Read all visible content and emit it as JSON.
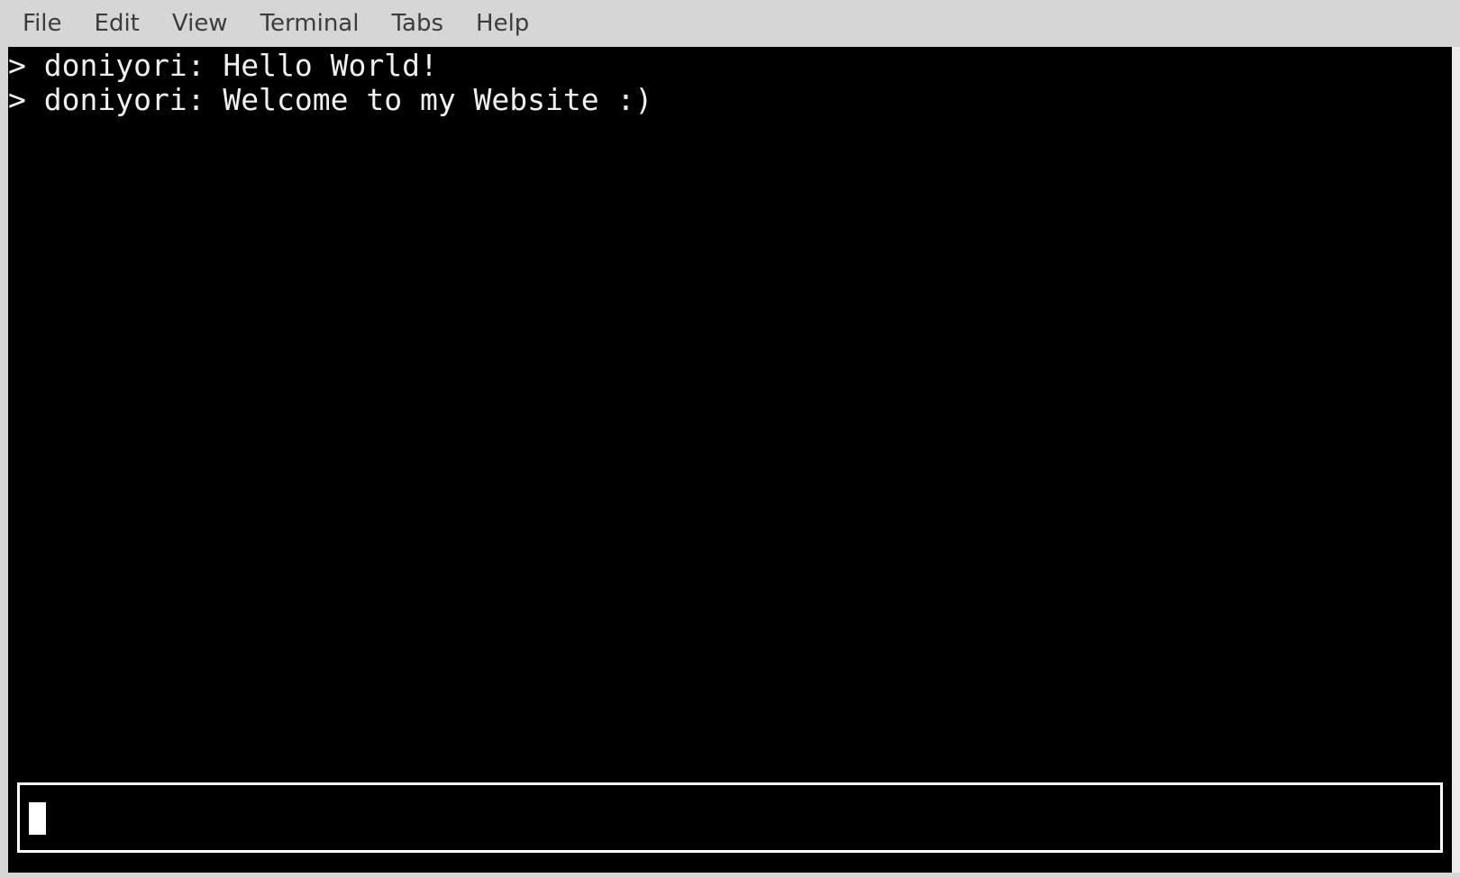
{
  "menubar": {
    "items": [
      {
        "label": "File"
      },
      {
        "label": "Edit"
      },
      {
        "label": "View"
      },
      {
        "label": "Terminal"
      },
      {
        "label": "Tabs"
      },
      {
        "label": "Help"
      }
    ]
  },
  "terminal": {
    "lines": [
      {
        "text": "> doniyori: Hello World!"
      },
      {
        "text": "> doniyori: Welcome to my Website :)"
      }
    ],
    "input": {
      "value": ""
    }
  },
  "colors": {
    "terminal_background": "#000000",
    "terminal_text": "#f0f0f0",
    "menubar_background": "#d6d6d6",
    "menu_text": "#3c3c3c"
  }
}
